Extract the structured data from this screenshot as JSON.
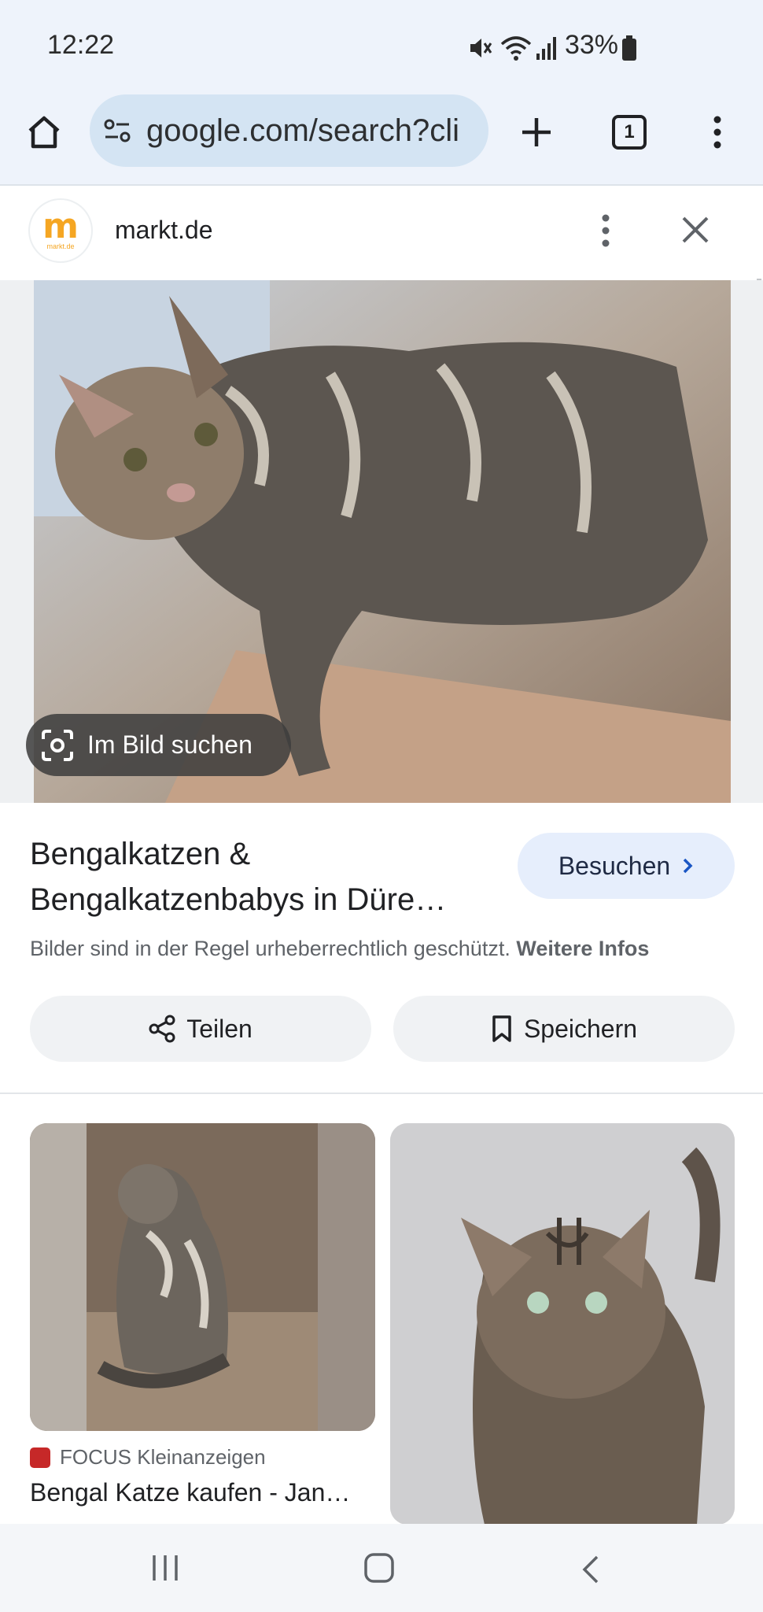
{
  "status_bar": {
    "time": "12:22",
    "battery": "33%",
    "icons": [
      "mute-icon",
      "wifi-icon",
      "signal-icon",
      "battery-icon"
    ]
  },
  "browser": {
    "url": "google.com/search?cli",
    "tab_count": "1"
  },
  "panel": {
    "site_name": "markt.de",
    "logo_letter": "m",
    "logo_sub": "markt.de",
    "lens_label": "Im Bild suchen",
    "title_line1": "Bengalkatzen &",
    "title_line2": "Bengalkatzenbabys in Düre…",
    "visit_label": "Besuchen",
    "copyright_text": "Bilder sind in der Regel urheberrechtlich geschützt.",
    "more_info": "Weitere Infos",
    "share_label": "Teilen",
    "save_label": "Speichern"
  },
  "related": [
    {
      "source": "FOCUS Kleinanzeigen",
      "caption": "Bengal Katze kaufen - Jan…"
    }
  ],
  "colors": {
    "accent_bg": "#e6eefc",
    "toolbar_bg": "#eef3fb",
    "logo": "#f5a623"
  }
}
